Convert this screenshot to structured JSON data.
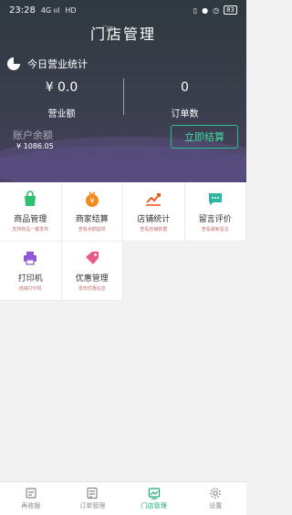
{
  "status_bar": {
    "time": "23:28",
    "signal": "4G ııl",
    "network": "HD",
    "battery": "83"
  },
  "header": {
    "title": "门店管理",
    "title_small": "门店",
    "stats_title": "今日营业统计",
    "revenue": {
      "value": "¥ 0.0",
      "label": "营业额"
    },
    "orders": {
      "value": "0",
      "label": "订单数"
    },
    "balance_label": "账户余额",
    "balance_value": "¥ 1086.05",
    "withdraw_label": "立即结算"
  },
  "grid_items": [
    {
      "name": "商品管理",
      "desc": "支持商品一键发布",
      "icon": "shopping-bag-icon",
      "color": "#2fbf71"
    },
    {
      "name": "商家结算",
      "desc": "查看余额提现",
      "icon": "money-bag-icon",
      "color": "#f28a1c"
    },
    {
      "name": "店铺统计",
      "desc": "查看店铺数据",
      "icon": "trend-chart-icon",
      "color": "#ef5a1e"
    },
    {
      "name": "留言评价",
      "desc": "查看最新留言",
      "icon": "chat-bubble-icon",
      "color": "#2bb7a0"
    },
    {
      "name": "打印机",
      "desc": "连接打印机",
      "icon": "printer-icon",
      "color": "#9256d9"
    },
    {
      "name": "优惠管理",
      "desc": "发布优惠信息",
      "icon": "coupon-tag-icon",
      "color": "#e9578b"
    }
  ],
  "tabs": [
    {
      "label": "再收银",
      "icon": "cashier-icon",
      "active": false
    },
    {
      "label": "订单管理",
      "icon": "order-list-icon",
      "active": false
    },
    {
      "label": "门店管理",
      "icon": "store-chart-icon",
      "active": true
    },
    {
      "label": "设置",
      "icon": "gear-icon",
      "active": false
    }
  ]
}
